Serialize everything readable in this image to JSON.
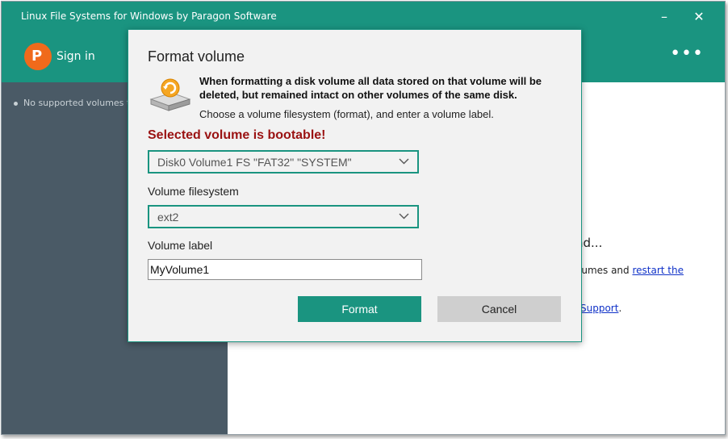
{
  "window": {
    "title": "Linux File Systems for Windows by Paragon Software",
    "minimize": "–",
    "close": "✕"
  },
  "toolbar": {
    "logo_letter": "P",
    "sign_in": "Sign in",
    "more": "•••"
  },
  "sidebar": {
    "empty_text": "No supported volumes to d"
  },
  "background": {
    "heading": "nd...",
    "line1_text": "lumes and ",
    "line1_link": "restart the",
    "line2_link": "Support",
    "line2_suffix": "."
  },
  "dialog": {
    "title": "Format volume",
    "warning": "When formatting a disk volume all data stored on that volume will be deleted, but remained intact on other volumes of the same disk.",
    "instruction": "Choose a volume filesystem (format), and enter a volume label.",
    "bootable_warning": "Selected volume is bootable!",
    "volume_select": {
      "value": "Disk0 Volume1 FS \"FAT32\" \"SYSTEM\""
    },
    "filesystem": {
      "label": "Volume filesystem",
      "value": "ext2"
    },
    "volume_label": {
      "label": "Volume label",
      "value": "MyVolume1"
    },
    "format_button": "Format",
    "cancel_button": "Cancel"
  },
  "colors": {
    "accent": "#1a9480",
    "sidebar": "#4a5a66",
    "warning_red": "#9a1212",
    "logo_orange": "#f06a1b"
  }
}
